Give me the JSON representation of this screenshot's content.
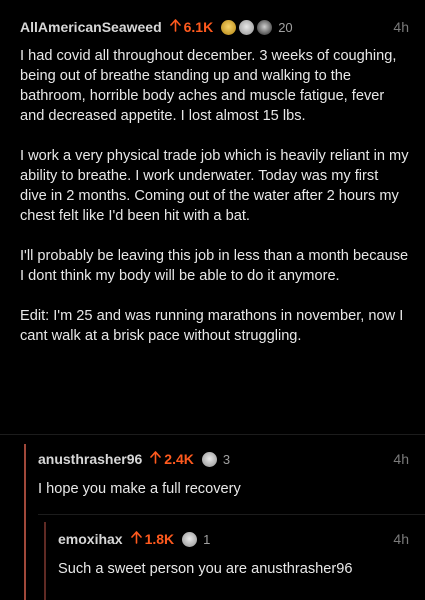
{
  "colors": {
    "background": "#000000",
    "upvote": "#ff5a1e",
    "thread_line_1": "#a0483a",
    "thread_line_2": "#5f2a24"
  },
  "main_comment": {
    "username": "AllAmericanSeaweed",
    "score": "6.1K",
    "awards": [
      "gold-award-icon",
      "silver-award-icon",
      "dark-award-icon"
    ],
    "award_count": "20",
    "time": "4h",
    "paragraphs": [
      "I had covid all throughout december. 3 weeks of coughing, being out of breathe standing up and walking to the bathroom, horrible body aches and muscle fatigue, fever and decreased appetite. I lost almost 15 lbs.",
      "I work a very physical trade job which is heavily reliant in my ability to breathe. I work underwater. Today was my first dive in 2 months. Coming out of the water after 2 hours my chest felt like I'd been hit with a bat.",
      "I'll probably be leaving this job in less than a month because I dont think my body will be able to do it anymore.",
      "Edit: I'm 25 and was running marathons in november, now I cant walk at a brisk pace without struggling."
    ]
  },
  "reply_1": {
    "username": "anusthrasher96",
    "score": "2.4K",
    "awards": [
      "silver-award-icon"
    ],
    "award_count": "3",
    "time": "4h",
    "text": "I hope you make a full recovery"
  },
  "reply_2": {
    "username": "emoxihax",
    "score": "1.8K",
    "awards": [
      "silver-award-icon"
    ],
    "award_count": "1",
    "time": "4h",
    "text": "Such a sweet person you are anusthrasher96"
  }
}
